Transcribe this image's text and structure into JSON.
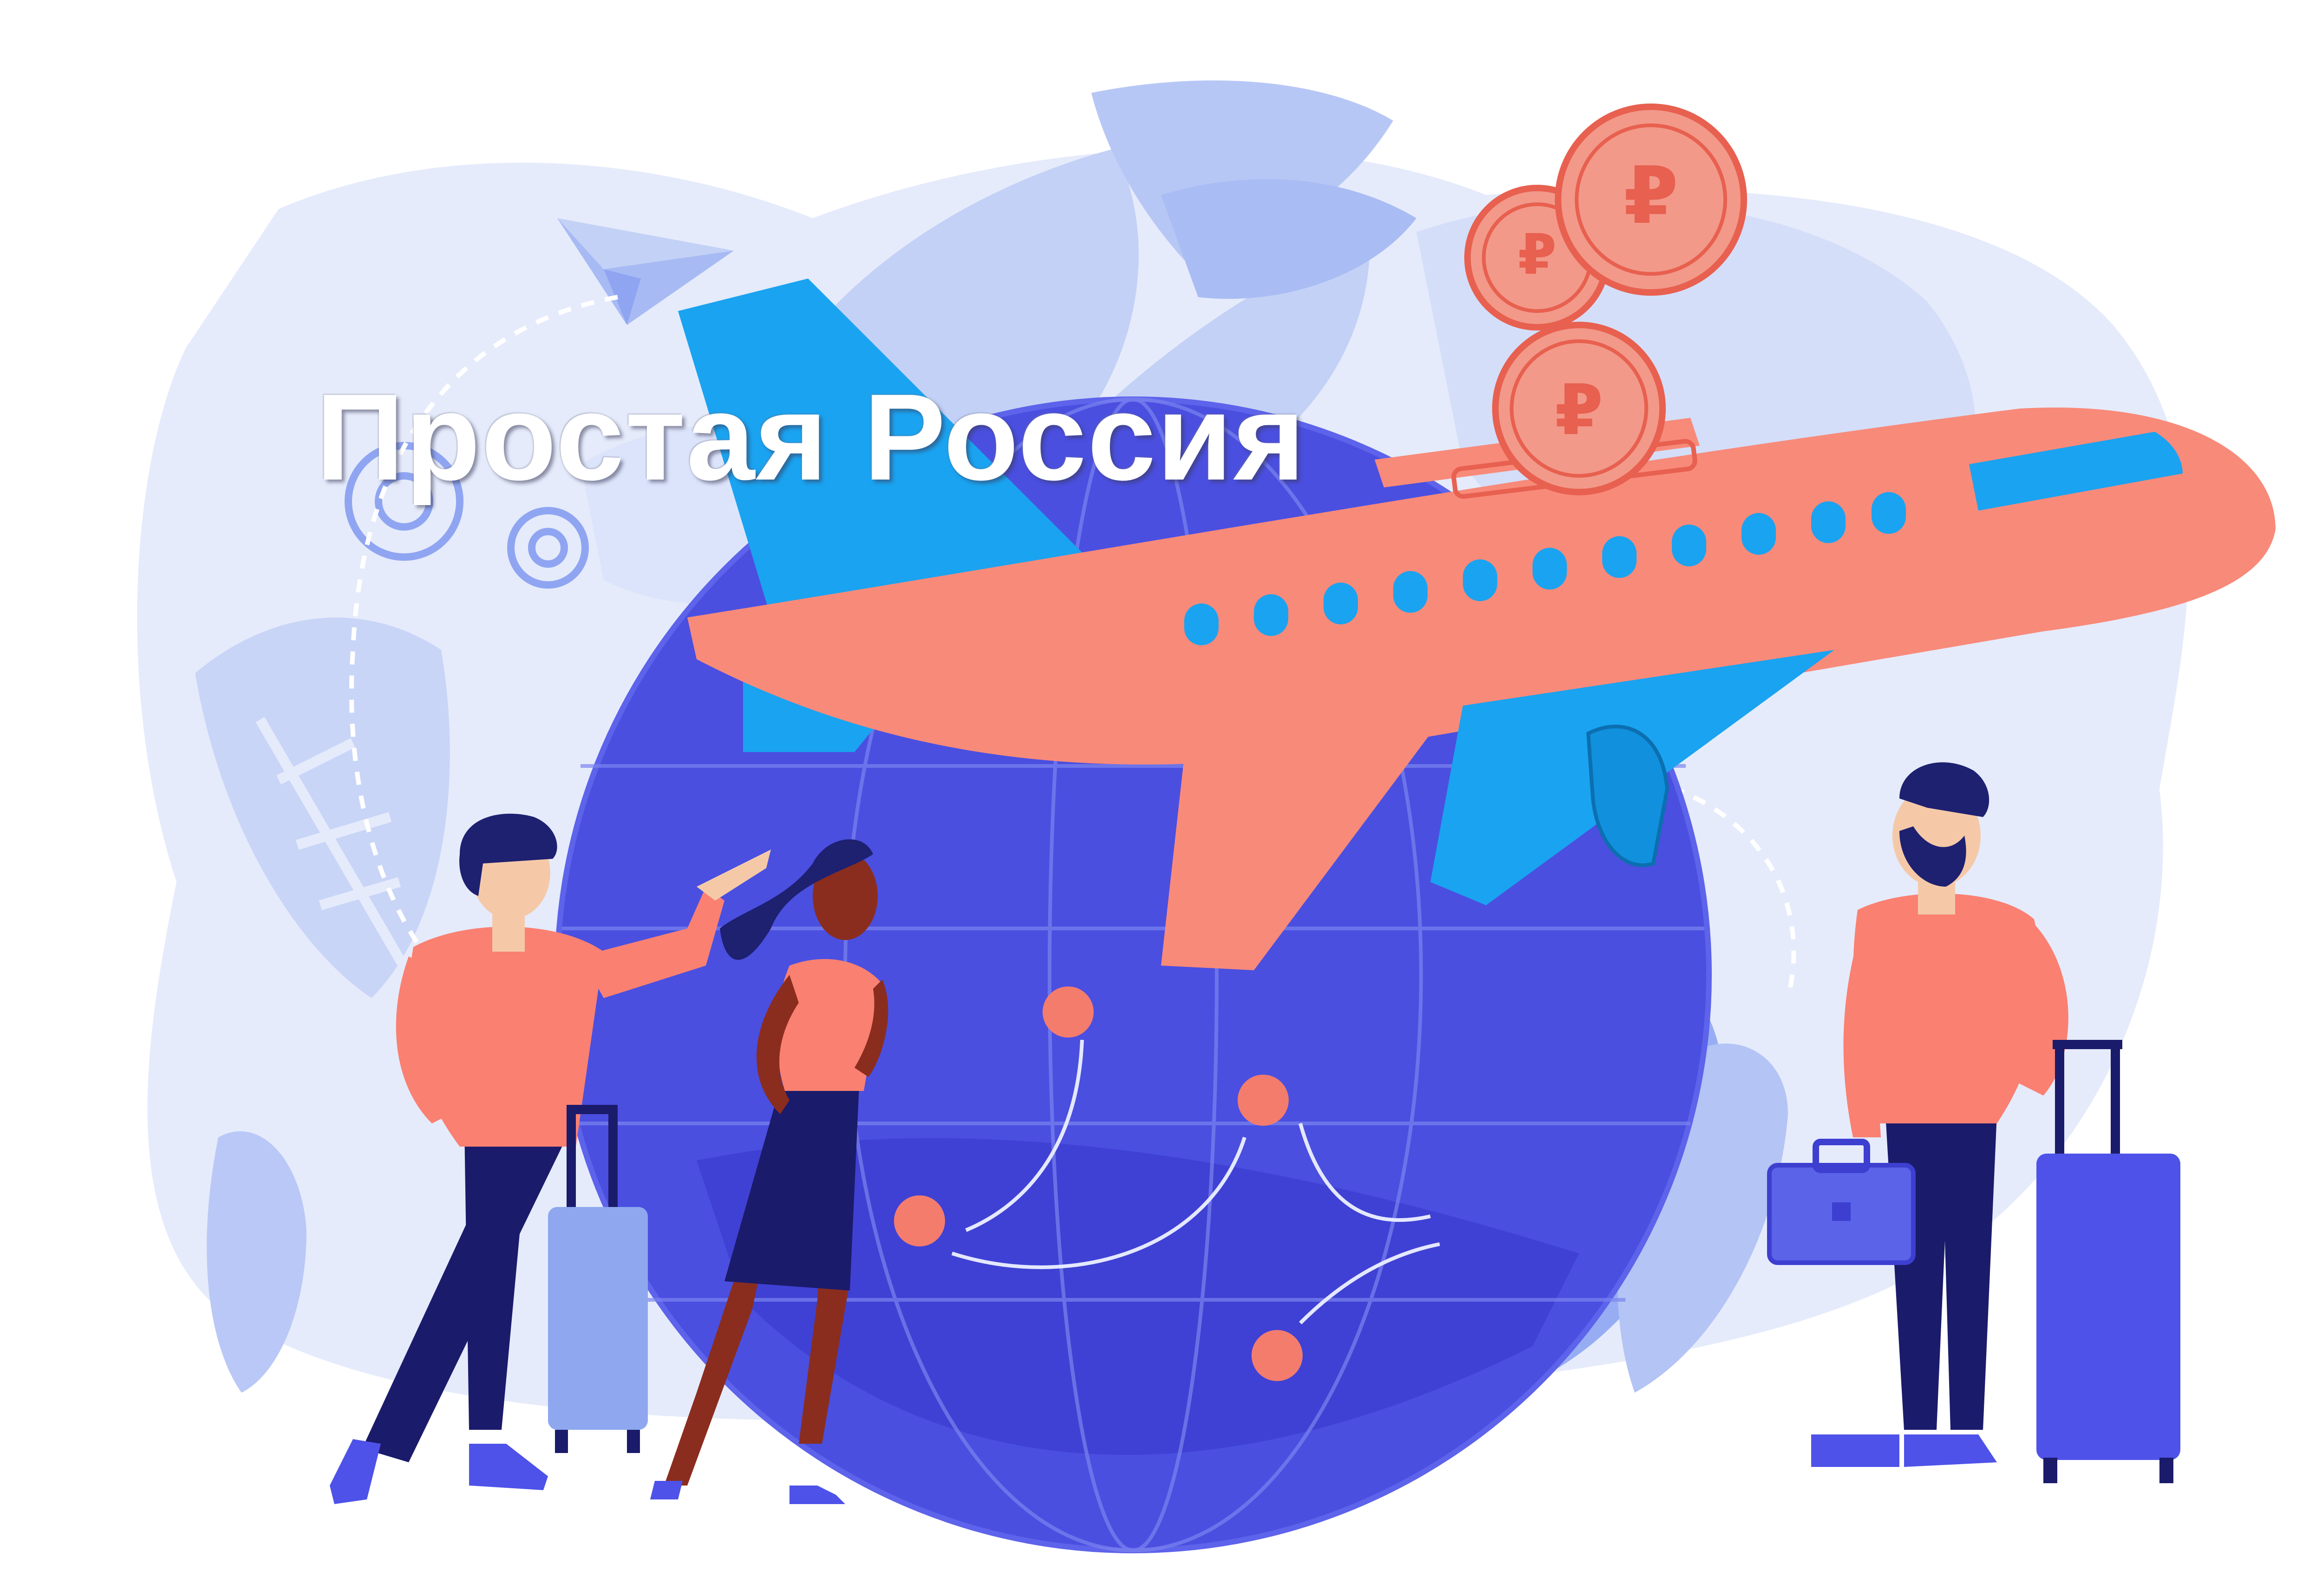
{
  "headline": "Простая Россия",
  "currency_symbol": "₽",
  "colors": {
    "background": "#ffffff",
    "pale_blue": "#e3e9fb",
    "light_blue": "#c9d6f8",
    "mid_blue": "#9db4f5",
    "globe_blue": "#4a4fe0",
    "globe_dark": "#3d3fd0",
    "navy": "#1b1b6b",
    "coral": "#fa8072",
    "coral_dark": "#e8604f",
    "coin": "#f2998a",
    "skin": "#f5c9a8",
    "sky_blue": "#1aa3f0",
    "suitcase_light": "#8ea7ee",
    "suitcase_dark": "#4e52e8",
    "hair": "#1e2070"
  },
  "icons": [
    "paper-plane-icon",
    "gear-icon",
    "airplane-icon",
    "ruble-coin-icon",
    "globe-icon",
    "suitcase-icon",
    "briefcase-icon"
  ]
}
